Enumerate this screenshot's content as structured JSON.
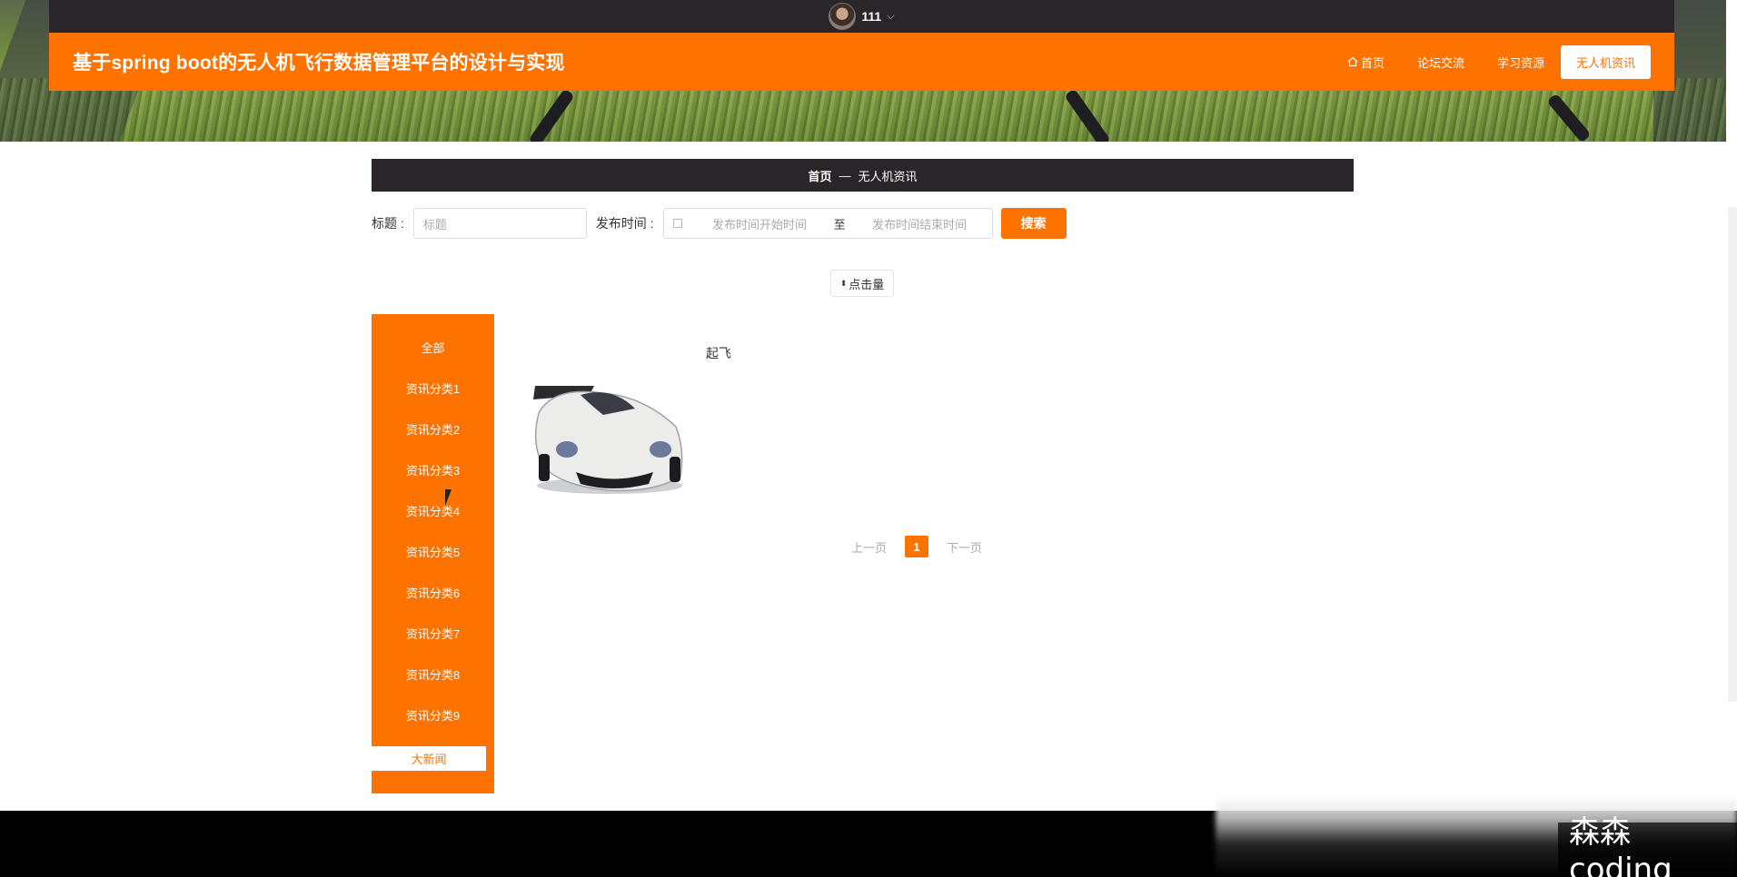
{
  "topbar": {
    "username": "111"
  },
  "header": {
    "title": "基于spring boot的无人机飞行数据管理平台的设计与实现",
    "nav": [
      {
        "label": "首页",
        "icon": "home-icon"
      },
      {
        "label": "论坛交流"
      },
      {
        "label": "学习资源"
      },
      {
        "label": "无人机资讯",
        "active": true
      }
    ]
  },
  "breadcrumb": {
    "home": "首页",
    "separator": "—",
    "current": "无人机资讯"
  },
  "search": {
    "title_label": "标题 :",
    "title_placeholder": "标题",
    "time_label": "发布时间 :",
    "start_placeholder": "发布时间开始时间",
    "range_separator": "至",
    "end_placeholder": "发布时间结束时间",
    "button_label": "搜索"
  },
  "sort": {
    "label": "点击量"
  },
  "categories": [
    "全部",
    "资讯分类1",
    "资讯分类2",
    "资讯分类3",
    "资讯分类4",
    "资讯分类5",
    "资讯分类6",
    "资讯分类7",
    "资讯分类8",
    "资讯分类9"
  ],
  "special_category": "大新闻",
  "items": [
    {
      "title": "起飞"
    }
  ],
  "pagination": {
    "prev": "上一页",
    "current": "1",
    "next": "下一页"
  },
  "watermark": "森森coding",
  "colors": {
    "accent": "#fe7200",
    "dark": "#2a2528"
  }
}
